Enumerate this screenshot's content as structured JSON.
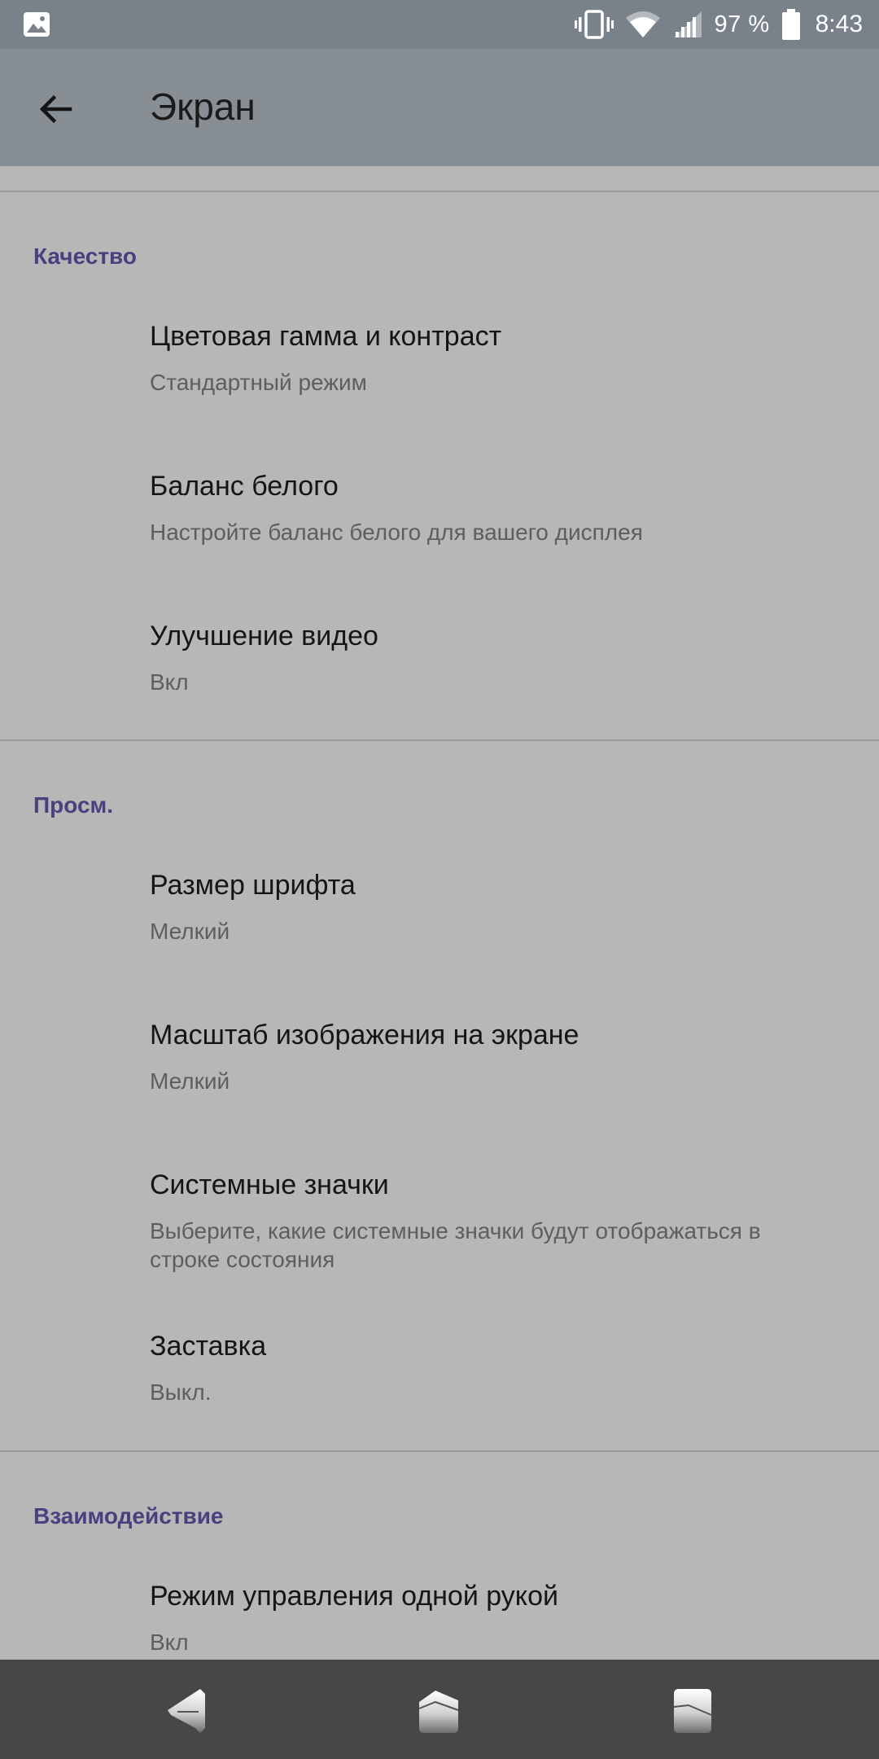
{
  "status_bar": {
    "icons": [
      "gallery-icon",
      "vibrate-icon",
      "wifi-icon",
      "signal-icon",
      "battery-icon"
    ],
    "battery_percent": "97 %",
    "time": "8:43"
  },
  "toolbar": {
    "back_icon": "arrow-back-icon",
    "title": "Экран"
  },
  "sections": [
    {
      "header": "Качество",
      "items": [
        {
          "title": "Цветовая гамма и контраст",
          "summary": "Стандартный режим"
        },
        {
          "title": "Баланс белого",
          "summary": "Настройте баланс белого для вашего дисплея"
        },
        {
          "title": "Улучшение видео",
          "summary": "Вкл"
        }
      ]
    },
    {
      "header": "Просм.",
      "items": [
        {
          "title": "Размер шрифта",
          "summary": "Мелкий"
        },
        {
          "title": "Масштаб изображения на экране",
          "summary": "Мелкий"
        },
        {
          "title": "Системные значки",
          "summary": "Выберите, какие системные значки будут отображаться в строке состояния"
        },
        {
          "title": "Заставка",
          "summary": "Выкл."
        }
      ]
    },
    {
      "header": "Взаимодействие",
      "items": [
        {
          "title": "Режим управления одной рукой",
          "summary": "Вкл"
        }
      ]
    }
  ],
  "nav_bar": {
    "icons": [
      "nav-back-icon",
      "nav-home-icon",
      "nav-recents-icon"
    ]
  },
  "colors": {
    "status_bar": "#79828a",
    "toolbar": "#888f94",
    "background": "#b8b6b7",
    "accent": "#4b3f80",
    "nav_bar": "#474747"
  }
}
